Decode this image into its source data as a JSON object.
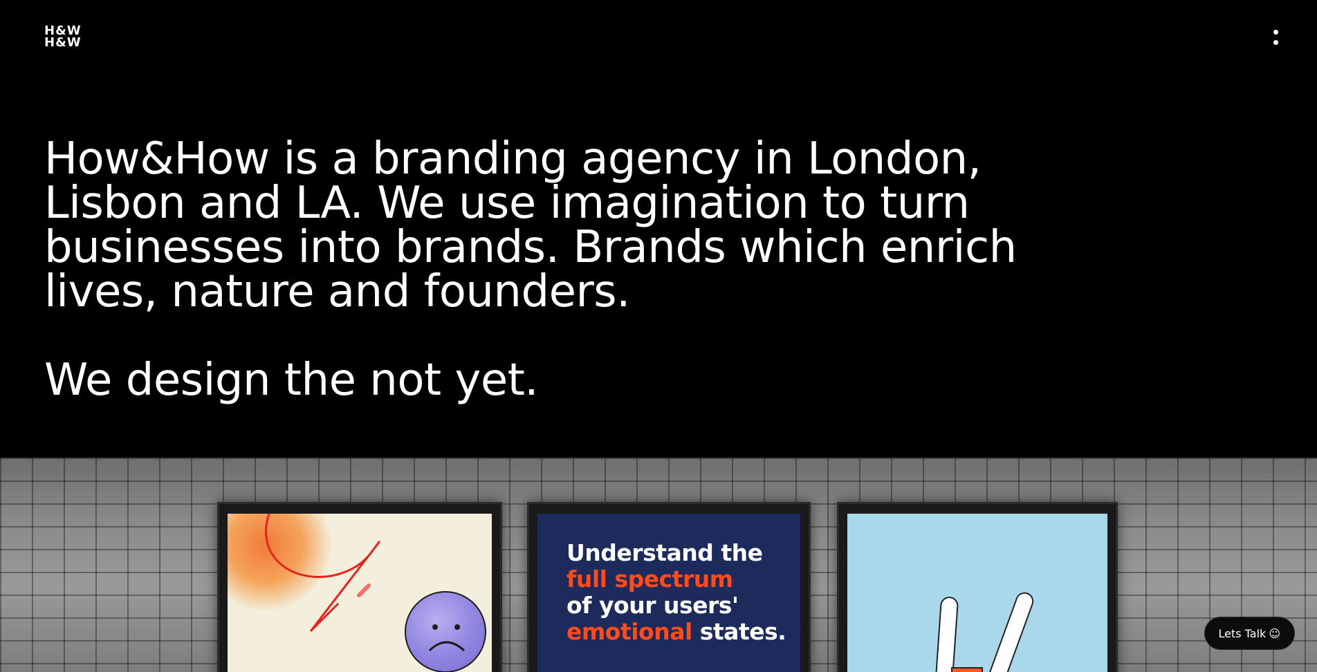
{
  "header": {
    "logo_line1": "H&W",
    "logo_line2": "H&W",
    "menu_icon": "vertical-dots-icon"
  },
  "hero": {
    "intro": "How&How is a branding agency in London, Lisbon and LA. We use imagination to turn businesses into brands. Brands which enrich lives, nature and founders.",
    "tagline": "We design the not yet."
  },
  "showcase": {
    "poster_2": {
      "line1": "Understand the",
      "line2": "full spectrum",
      "line3": "of your users'",
      "line4a": "emotional",
      "line4b": " states."
    },
    "colors": {
      "accent": "#ff4a1c",
      "poster_navy": "#1d2b5c",
      "poster_sky": "#a9d8ea",
      "poster_cream": "#f3efdc"
    }
  },
  "cta": {
    "label": "Lets Talk",
    "icon": "smiley-icon",
    "icon_glyph": "☺"
  }
}
